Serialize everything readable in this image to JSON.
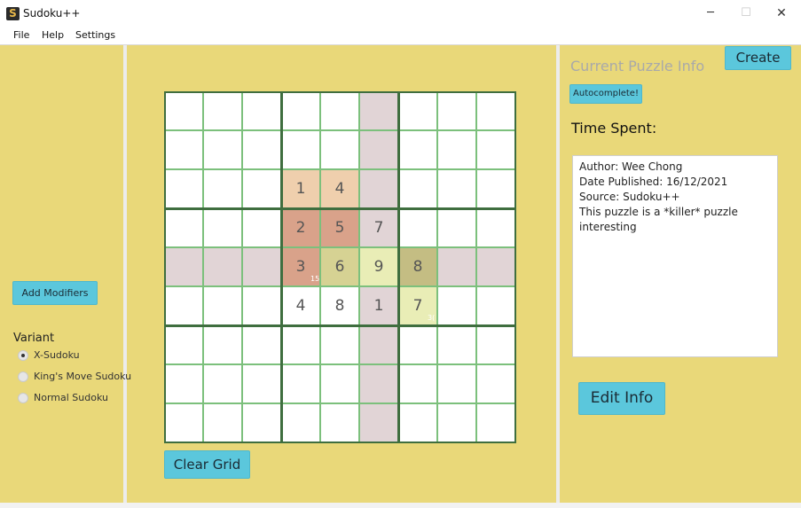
{
  "window": {
    "app_icon_letter": "S",
    "title": "Sudoku++",
    "minimize_glyph": "─",
    "maximize_glyph": "☐",
    "close_glyph": "✕"
  },
  "menu": [
    "File",
    "Help",
    "Settings"
  ],
  "left_panel": {
    "add_modifiers_label": "Add Modifiers",
    "variant_title": "Variant",
    "variants": [
      {
        "label": "X-Sudoku",
        "selected": true
      },
      {
        "label": "King's Move Sudoku",
        "selected": false
      },
      {
        "label": "Normal Sudoku",
        "selected": false
      }
    ]
  },
  "center_panel": {
    "clear_grid_label": "Clear Grid"
  },
  "grid": {
    "values": [
      [
        "",
        "",
        "",
        "",
        "",
        "",
        "",
        "",
        ""
      ],
      [
        "",
        "",
        "",
        "",
        "",
        "",
        "",
        "",
        ""
      ],
      [
        "",
        "",
        "",
        "1",
        "4",
        "",
        "",
        "",
        ""
      ],
      [
        "",
        "",
        "",
        "2",
        "5",
        "7",
        "",
        "",
        ""
      ],
      [
        "",
        "",
        "",
        "3",
        "6",
        "9",
        "8",
        "",
        ""
      ],
      [
        "",
        "",
        "",
        "4",
        "8",
        "1",
        "7",
        "",
        ""
      ],
      [
        "",
        "",
        "",
        "",
        "",
        "",
        "",
        "",
        ""
      ],
      [
        "",
        "",
        "",
        "",
        "",
        "",
        "",
        "",
        ""
      ],
      [
        "",
        "",
        "",
        "",
        "",
        "",
        "",
        "",
        ""
      ]
    ],
    "cage_sums": [
      {
        "text": "15",
        "row": 4,
        "col": 3
      },
      {
        "text": "3(",
        "row": 5,
        "col": 6
      }
    ],
    "colors": {
      "highlight_line": "#e1d4d6",
      "peach": "#efcfad",
      "brown": "#d9a28a",
      "olive": "#d6d293",
      "dark_olive": "#c4bd83",
      "light_green": "#e9edb6",
      "thin_border": "#7cc07c",
      "thick_border": "#3f6e3f"
    }
  },
  "right_panel": {
    "create_label": "Create",
    "section_title": "Current Puzzle Info",
    "autocomplete_label": "Autocomplete!",
    "time_spent_label": "Time Spent:",
    "info_lines": [
      "Author: Wee Chong",
      "Date Published: 16/12/2021",
      "Source: Sudoku++",
      "This puzzle is a *killer* puzzle",
      "interesting"
    ],
    "edit_info_label": "Edit Info"
  }
}
